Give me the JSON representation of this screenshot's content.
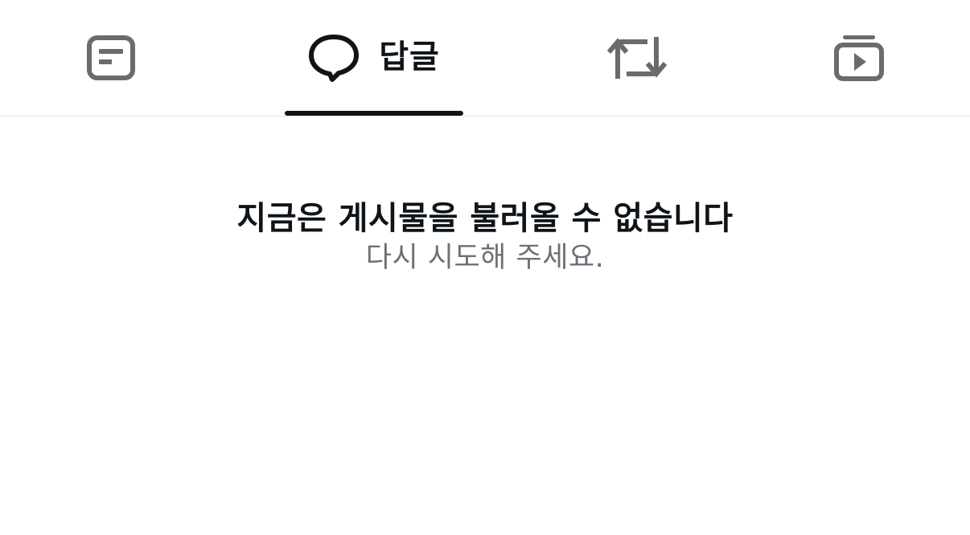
{
  "tabs": [
    {
      "id": "posts",
      "icon": "post-list-icon",
      "label": "",
      "selected": false
    },
    {
      "id": "replies",
      "icon": "speech-bubble-icon",
      "label": "답글",
      "selected": true
    },
    {
      "id": "reposts",
      "icon": "repost-icon",
      "label": "",
      "selected": false
    },
    {
      "id": "videos",
      "icon": "video-stack-icon",
      "label": "",
      "selected": false
    }
  ],
  "empty_state": {
    "title": "지금은 게시물을 불러올 수 없습니다",
    "subtitle": "다시 시도해 주세요."
  },
  "colors": {
    "selected_tab": "#0f1419",
    "unselected_icon": "#6b6b6b",
    "subtitle_text": "#6b7177",
    "divider": "#e6e6e6",
    "background": "#ffffff"
  }
}
